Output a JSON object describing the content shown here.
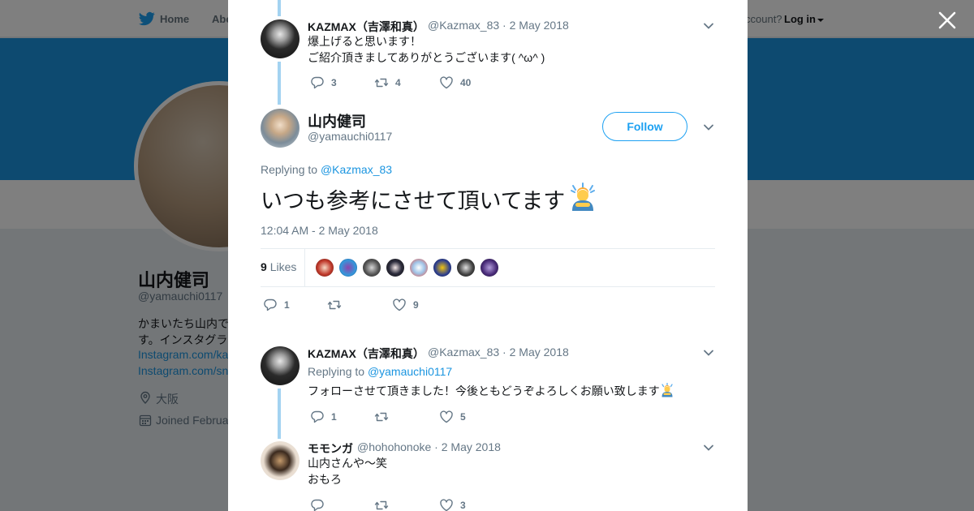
{
  "nav": {
    "home": "Home",
    "about": "Abo",
    "account_prompt": "ccount?",
    "login": "Log in"
  },
  "profile": {
    "name": "山内健司",
    "handle": "@yamauchi0117",
    "bio_line1": "かまいたち山内で",
    "bio_line2": "す。インスタグラ",
    "link1": "Instagram.com/ka",
    "link2": "Instagram.com/sn",
    "location": "大阪",
    "joined": "Joined Februa"
  },
  "tweets": [
    {
      "name": "KAZMAX（吉澤和真）",
      "handle": "@Kazmax_83",
      "date": "2 May 2018",
      "lines": [
        "爆上げると思います！",
        "ご紹介頂きましてありがとうございます( ^ω^ )"
      ],
      "replies": "3",
      "retweets": "4",
      "likes": "40"
    },
    {
      "name": "KAZMAX（吉澤和真）",
      "handle": "@Kazmax_83",
      "date": "2 May 2018",
      "replying_label": "Replying to",
      "replying_to": "@yamauchi0117",
      "lines": [
        "フォローさせて頂きました！今後ともどうぞよろしくお願い致します"
      ],
      "replies": "1",
      "retweets": "",
      "likes": "5"
    },
    {
      "name": "モモンガ",
      "handle": "@hohohonoke",
      "date": "2 May 2018",
      "lines": [
        "山内さんや〜笑",
        "おもろ"
      ],
      "replies": "",
      "retweets": "",
      "likes": "3"
    }
  ],
  "main_tweet": {
    "name": "山内健司",
    "handle": "@yamauchi0117",
    "follow_label": "Follow",
    "replying_label": "Replying to",
    "replying_to": "@Kazmax_83",
    "text": "いつも参考にさせて頂いてます",
    "timestamp": "12:04 AM - 2 May 2018",
    "likes_count": "9",
    "likes_label": "Likes",
    "replies": "1",
    "retweets": "",
    "likes": "9"
  },
  "colors": {
    "accent": "#1da1f2",
    "link": "#1b95e0",
    "thread_line": "#a3d3f1",
    "banner": "#1b95e0"
  },
  "icons": [
    "twitter-bird-icon",
    "reply-icon",
    "retweet-icon",
    "heart-icon",
    "chevron-down-icon",
    "close-icon",
    "location-icon",
    "calendar-icon",
    "person-bowing-emoji"
  ]
}
